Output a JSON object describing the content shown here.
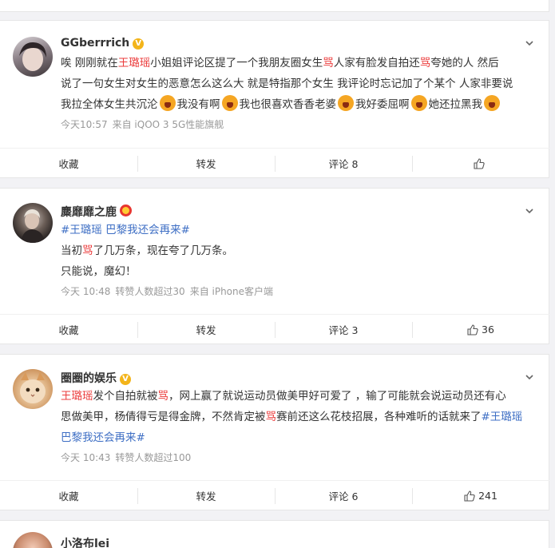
{
  "posts": [
    {
      "name": "GGberrrich",
      "body_lines": [
        [
          {
            "t": "唉 刚刚就在"
          },
          {
            "t": "王璐瑶",
            "c": "red"
          },
          {
            "t": "小姐姐评论区提了一个我朋友圈女生"
          },
          {
            "t": "骂",
            "c": "red"
          },
          {
            "t": "人家有脸发自拍还"
          },
          {
            "t": "骂",
            "c": "red"
          },
          {
            "t": "夸她的人 然后"
          }
        ],
        [
          {
            "t": "说了一句女生对女生的恶意怎么这么大 就是特指那个女生 我评论时忘记加了个某个 人家非要说"
          }
        ],
        [
          {
            "t": "我拉全体女生共沉沦"
          },
          {
            "e": "emoji-icon"
          },
          {
            "t": "我没有啊"
          },
          {
            "e": "emoji-icon"
          },
          {
            "t": "我也很喜欢香香老婆"
          },
          {
            "e": "emoji-icon"
          },
          {
            "t": "我好委屈啊"
          },
          {
            "e": "emoji-icon"
          },
          {
            "t": "她还拉黑我"
          },
          {
            "e": "emoji-icon"
          }
        ]
      ],
      "meta": [
        "今天10:57",
        "来自 iQOO 3 5G性能旗舰"
      ],
      "actions": {
        "fav": "收藏",
        "repost": "转发",
        "comment": "评论 8",
        "like": ""
      }
    },
    {
      "name": "麋靡靡之鹿",
      "body_lines": [
        [
          {
            "t": "#王璐瑶 巴黎我还会再来#",
            "c": "blue"
          }
        ],
        [
          {
            "t": "当初"
          },
          {
            "t": "骂",
            "c": "red"
          },
          {
            "t": "了几万条，现在夸了几万条。"
          }
        ],
        [
          {
            "t": "只能说，魔幻！"
          }
        ]
      ],
      "meta": [
        "今天 10:48",
        "转赞人数超过30",
        "来自 iPhone客户端"
      ],
      "actions": {
        "fav": "收藏",
        "repost": "转发",
        "comment": "评论 3",
        "like": "36"
      }
    },
    {
      "name": "圈圈的娱乐",
      "body_lines": [
        [
          {
            "t": "王璐瑶",
            "c": "red"
          },
          {
            "t": "发个自拍就被"
          },
          {
            "t": "骂",
            "c": "red"
          },
          {
            "t": "，网上赢了就说运动员做美甲好可爱了 ，输了可能就会说运动员还有心"
          }
        ],
        [
          {
            "t": "思做美甲，杨倩得亏是得金牌，不然肯定被"
          },
          {
            "t": "骂",
            "c": "red"
          },
          {
            "t": "赛前还这么花枝招展，各种难听的话就来了"
          },
          {
            "t": "#王璐瑶",
            "c": "blue"
          }
        ],
        [
          {
            "t": "巴黎我还会再来#",
            "c": "blue"
          }
        ]
      ],
      "meta": [
        "今天 10:43",
        "转赞人数超过100"
      ],
      "actions": {
        "fav": "收藏",
        "repost": "转发",
        "comment": "评论 6",
        "like": "241"
      }
    },
    {
      "name": "小洛布lei"
    }
  ]
}
